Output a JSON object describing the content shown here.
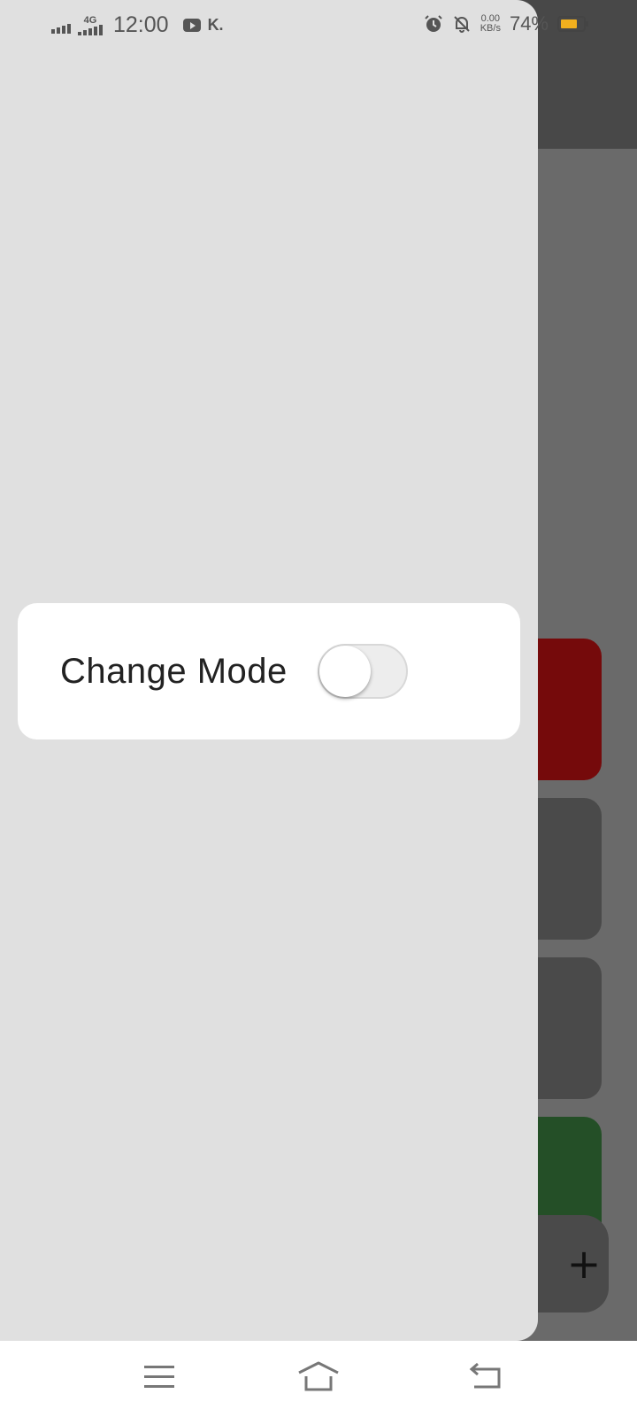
{
  "status_bar": {
    "network_type": "4G",
    "time": "12:00",
    "speed_value": "0.00",
    "speed_unit": "KB/s",
    "battery_percent": "74%",
    "battery_level": 0.74,
    "battery_color": "#f2b01e",
    "icons": [
      "signal-icon",
      "signal-4g-icon",
      "youtube-icon",
      "k-app-icon",
      "alarm-icon",
      "bell-off-icon",
      "battery-icon"
    ]
  },
  "drawer": {
    "mode_card": {
      "label": "Change Mode",
      "toggle_on": false
    }
  },
  "background_app": {
    "fab_label": "+",
    "card_colors": [
      "#750a0b",
      "#4a4a4a",
      "#4a4a4a",
      "#244f27"
    ]
  },
  "nav_bar": {
    "icons": [
      "menu-icon",
      "home-icon",
      "back-icon"
    ]
  }
}
